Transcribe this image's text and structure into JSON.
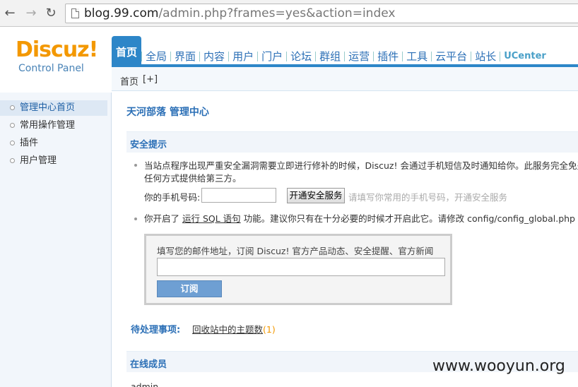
{
  "browser": {
    "url_host": "blog.99.com",
    "url_path": "/admin.php?frames=yes&action=index"
  },
  "header": {
    "logo_text": "Discuz!",
    "logo_sub": "Control Panel",
    "tabs": [
      "首页",
      "全局",
      "界面",
      "内容",
      "用户",
      "门户",
      "论坛",
      "群组",
      "运营",
      "插件",
      "工具",
      "云平台",
      "站长",
      "UCenter"
    ],
    "active_tab": "首页"
  },
  "breadcrumb": {
    "current": "首页",
    "add": "[+]"
  },
  "sidebar": {
    "items": [
      {
        "label": "管理中心首页"
      },
      {
        "label": "常用操作管理"
      },
      {
        "label": "插件"
      },
      {
        "label": "用户管理"
      }
    ]
  },
  "main": {
    "site_title": "天河部落 管理中心",
    "security": {
      "heading": "安全提示",
      "tip1_line1": "当站点程序出现严重安全漏洞需要立即进行修补的时候，Discuz! 会通过手机短信及时通知给你。此服务完全免费，且",
      "tip1_line2": "任何方式提供给第三方。",
      "phone_label": "你的手机号码:",
      "phone_value": "",
      "open_button": "开通安全服务",
      "phone_hint": "请填写你常用的手机号码，开通安全服务",
      "tip2_prefix": "你开启了",
      "tip2_link": "运行 SQL 语句",
      "tip2_suffix": "功能。建议你只有在十分必要的时候才开启此它。请修改 config/config_global.php 关闭此"
    },
    "subscribe": {
      "label": "填写您的邮件地址，订阅 Discuz! 官方产品动态、安全提醒、官方新闻",
      "email_value": "",
      "button": "订阅"
    },
    "pending": {
      "label": "待处理事项:",
      "link": "回收站中的主题数",
      "count": "(1)"
    },
    "online": {
      "heading": "在线成员",
      "user": "admin"
    }
  },
  "watermark": "www.wooyun.org",
  "colors": {
    "accent": "#2d86c8",
    "logo": "#f39800",
    "link": "#2b6fb6"
  }
}
